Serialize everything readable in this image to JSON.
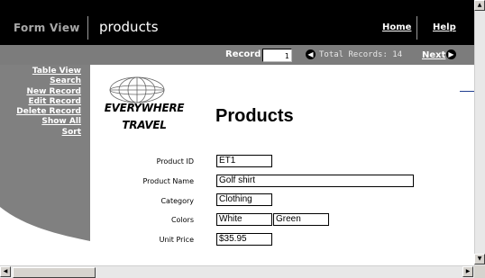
{
  "header": {
    "view_label": "Form View",
    "page_name": "products",
    "home_link": "Home",
    "help_link": "Help"
  },
  "record_bar": {
    "record_label": "Record",
    "record_value": "1",
    "total_label": "Total Records: 14",
    "next_label": "Next"
  },
  "sidebar": {
    "items": [
      {
        "label": "Table View"
      },
      {
        "label": "Search"
      },
      {
        "label": "New Record"
      },
      {
        "label": "Edit Record"
      },
      {
        "label": "Delete Record"
      },
      {
        "label": "Show All"
      },
      {
        "label": "Sort"
      }
    ]
  },
  "logo": {
    "line1": "EVERYWHERE",
    "line2": "TRAVEL"
  },
  "main": {
    "heading": "Products",
    "fields": {
      "product_id": {
        "label": "Product ID",
        "value": "ET1"
      },
      "product_name": {
        "label": "Product Name",
        "value": "Golf shirt"
      },
      "category": {
        "label": "Category",
        "value": "Clothing"
      },
      "colors": {
        "label": "Colors",
        "values": [
          "White",
          "Green"
        ]
      },
      "unit_price": {
        "label": "Unit Price",
        "value": "$35.95"
      }
    }
  },
  "colors": {
    "header_bg": "#000000",
    "record_bar_bg": "#7c7c7c",
    "sidebar_bg": "#808080",
    "accent_line": "#1f3d8f"
  },
  "icons": {
    "prev_record": "circle-arrow-left-icon",
    "next_record": "circle-arrow-right-icon",
    "logo": "globe-icon"
  }
}
